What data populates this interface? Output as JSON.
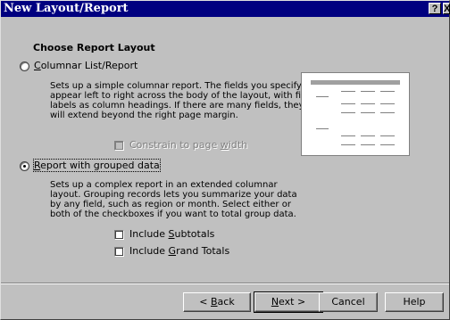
{
  "window": {
    "title": "New Layout/Report",
    "help_btn": "?",
    "close_btn": "X"
  },
  "section_heading": "Choose Report Layout",
  "options": {
    "columnar": {
      "label_pre": "",
      "label_ul": "C",
      "label_post": "olumnar List/Report",
      "selected": false,
      "description": "Sets up a simple columnar report.  The fields you specify appear left to right across the body of the layout, with field labels as column headings.  If there are many fields, they will extend beyond the right page margin.",
      "constrain": {
        "label_pre": "Constrain to page ",
        "label_ul": "w",
        "label_post": "idth",
        "checked": false,
        "enabled": false
      }
    },
    "grouped": {
      "label_pre": "",
      "label_ul": "R",
      "label_post": "eport with grouped data",
      "selected": true,
      "description": "Sets up a complex report in an extended columnar layout. Grouping records lets you summarize your data by any field, such as region or month. Select either or both of the checkboxes if you want to total group data.",
      "subtotals": {
        "label_pre": "Include ",
        "label_ul": "S",
        "label_post": "ubtotals",
        "checked": false
      },
      "grandtotals": {
        "label_pre": "Include ",
        "label_ul": "G",
        "label_post": "rand Totals",
        "checked": false
      }
    }
  },
  "buttons": {
    "back": {
      "pre": "< ",
      "ul": "B",
      "post": "ack"
    },
    "next": {
      "pre": "",
      "ul": "N",
      "post": "ext >"
    },
    "cancel": "Cancel",
    "help": "Help"
  }
}
